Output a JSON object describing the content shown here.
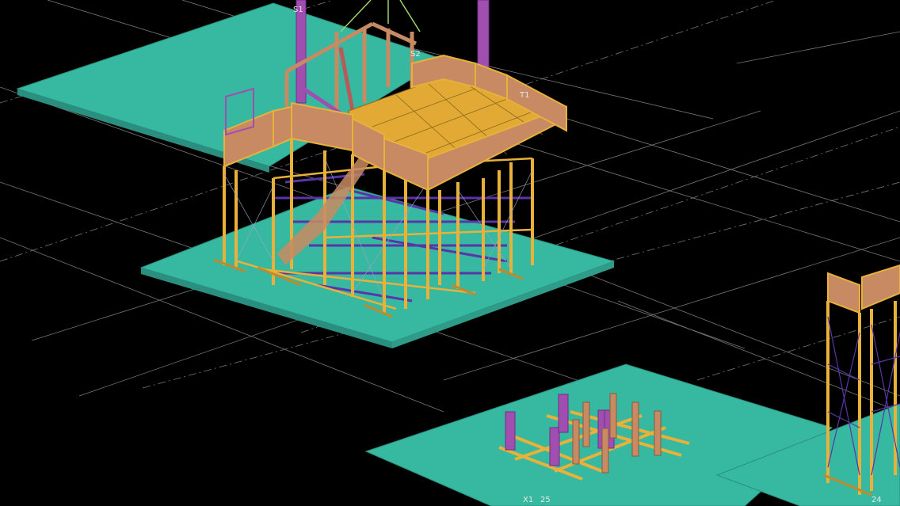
{
  "viewport": {
    "background": "#000000",
    "description_colors": {
      "slab": "#37b8a0",
      "slab_edge": "#2a8f7f",
      "scaffold_tube": "#e8b13a",
      "bracing": "#5a35a8",
      "column": "#a04fb0",
      "deck": "#e2a935",
      "toe_board": "#c88a62",
      "grid_line": "#d9d9d9"
    }
  },
  "grid_labels": {
    "s1": "S1",
    "s2": "S2",
    "t1": "T1",
    "x1": "X1",
    "n25": "25",
    "n24": "24"
  }
}
